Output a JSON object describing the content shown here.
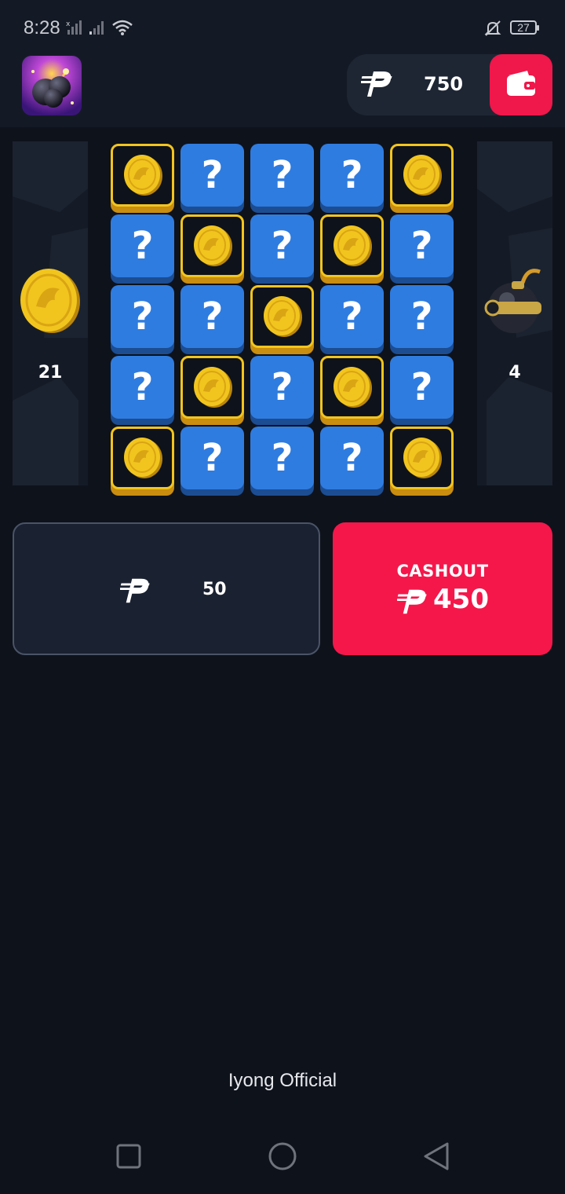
{
  "status_bar": {
    "time": "8:28",
    "battery": "27"
  },
  "header": {
    "logo": "bomb-game-logo",
    "currency_icon": "peso-icon",
    "balance": "750",
    "wallet_icon": "wallet-icon"
  },
  "side_left": {
    "icon": "coin-icon",
    "count": "21"
  },
  "side_right": {
    "icon": "bomb-icon",
    "count": "4"
  },
  "grid": {
    "rows": 5,
    "cols": 5,
    "tiles": [
      [
        "coin",
        "hidden",
        "hidden",
        "hidden",
        "coin"
      ],
      [
        "hidden",
        "coin",
        "hidden",
        "coin",
        "hidden"
      ],
      [
        "hidden",
        "hidden",
        "coin",
        "hidden",
        "hidden"
      ],
      [
        "hidden",
        "coin",
        "hidden",
        "coin",
        "hidden"
      ],
      [
        "coin",
        "hidden",
        "hidden",
        "hidden",
        "coin"
      ]
    ],
    "hidden_symbol": "?"
  },
  "bet": {
    "currency_icon": "peso-icon",
    "amount": "50"
  },
  "cashout": {
    "label": "CASHOUT",
    "currency_icon": "peso-icon",
    "amount": "450"
  },
  "footer": {
    "text": "Iyong Official"
  },
  "colors": {
    "background": "#0e121b",
    "accent_red": "#f5174a",
    "tile_blue": "#2f7ce0",
    "coin_gold": "#f2c51e"
  }
}
